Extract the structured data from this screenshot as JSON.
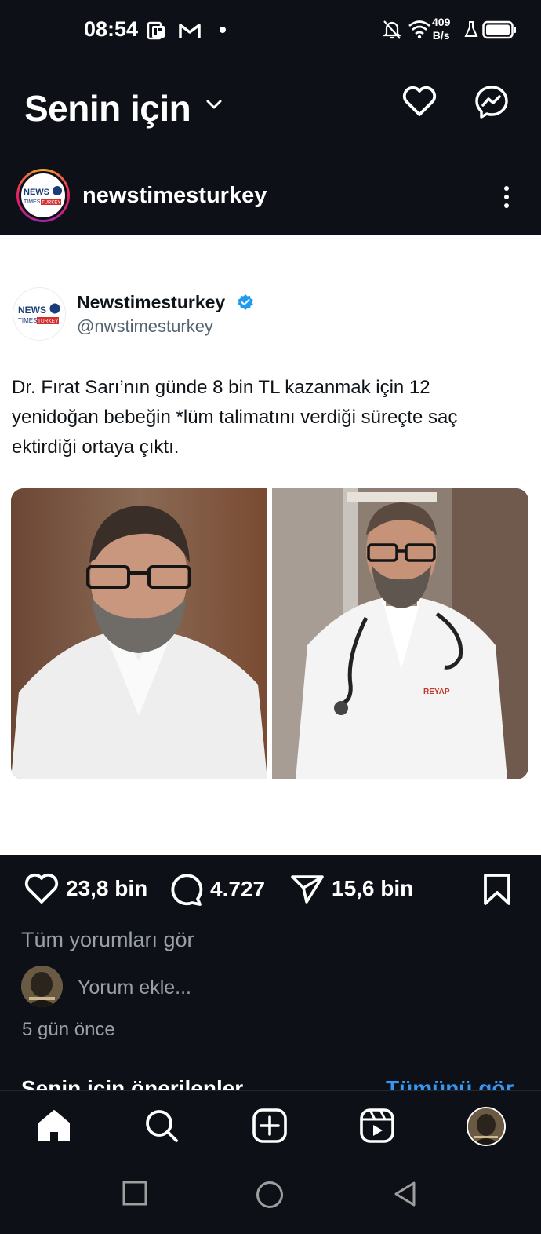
{
  "status_bar": {
    "time": "08:54",
    "net_speed_value": "409",
    "net_speed_unit": "B/s",
    "icons": [
      "pdf-icon",
      "gmail-icon",
      "dot-icon",
      "mute-bell-icon",
      "wifi-icon",
      "lab-flask-icon",
      "battery-icon"
    ]
  },
  "header": {
    "title": "Senin için",
    "icons": [
      "chevron-down-icon",
      "heart-icon",
      "messenger-icon"
    ]
  },
  "post": {
    "author": "newstimesturkey",
    "logo_text_top": "NEWS",
    "logo_text_bottom": "TIMES TURKEY",
    "tweet": {
      "display_name": "Newstimesturkey",
      "handle": "@nwstimesturkey",
      "text": "Dr. Fırat Sarı’nın günde 8 bin TL kazanmak için 12 yenidoğan bebeğin *lüm talimatını verdiği süreçte saç ektirdiği ortaya çıktı."
    },
    "likes": "23,8 bin",
    "comments": "4.727",
    "shares": "15,6 bin",
    "view_comments": "Tüm yorumları gör",
    "add_comment_placeholder": "Yorum ekle...",
    "time_ago": "5 gün önce"
  },
  "suggestions": {
    "title": "Senin için önerilenler",
    "see_all": "Tümünü gör"
  },
  "bottom_nav": [
    "home-icon",
    "search-icon",
    "create-icon",
    "reels-icon",
    "profile-avatar"
  ],
  "system_nav": [
    "recents-icon",
    "home-circle-icon",
    "back-icon"
  ],
  "colors": {
    "background": "#0d1016",
    "link": "#3797f0",
    "verified": "#1d9bf0",
    "muted_text": "#9aa0a8"
  }
}
